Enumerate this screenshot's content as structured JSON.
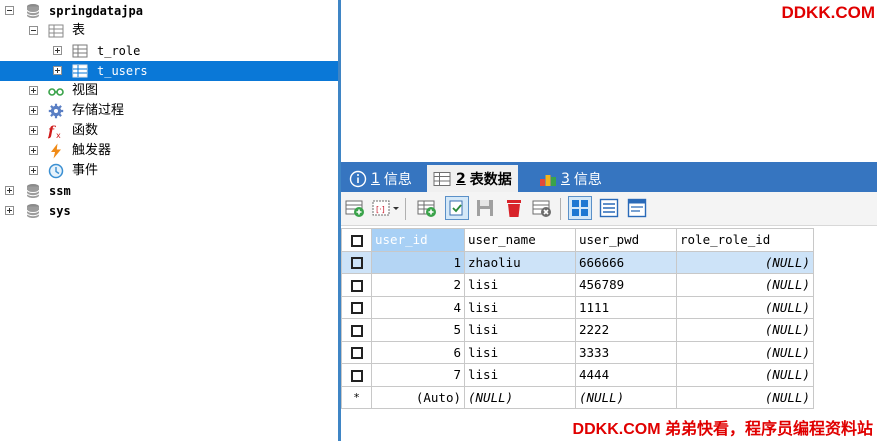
{
  "tree": {
    "db_springdatajpa": "springdatajpa",
    "tables_folder": "表",
    "table_role": "t_role",
    "table_users": "t_users",
    "views": "视图",
    "procedures": "存储过程",
    "functions": "函数",
    "triggers": "触发器",
    "events": "事件",
    "db_ssm": "ssm",
    "db_sys": "sys"
  },
  "watermark_top": "DDKK.COM",
  "watermark_bottom": "DDKK.COM 弟弟快看，程序员编程资料站",
  "tabs": [
    {
      "num": "1",
      "label": "信息",
      "active": false
    },
    {
      "num": "2",
      "label": "表数据",
      "active": true
    },
    {
      "num": "3",
      "label": "信息",
      "active": false
    }
  ],
  "grid": {
    "columns": [
      "user_id",
      "user_name",
      "user_pwd",
      "role_role_id"
    ],
    "rows": [
      {
        "user_id": "1",
        "user_name": "zhaoliu",
        "user_pwd": "666666",
        "role_role_id": "(NULL)"
      },
      {
        "user_id": "2",
        "user_name": "lisi",
        "user_pwd": "456789",
        "role_role_id": "(NULL)"
      },
      {
        "user_id": "4",
        "user_name": "lisi",
        "user_pwd": "1111",
        "role_role_id": "(NULL)"
      },
      {
        "user_id": "5",
        "user_name": "lisi",
        "user_pwd": "2222",
        "role_role_id": "(NULL)"
      },
      {
        "user_id": "6",
        "user_name": "lisi",
        "user_pwd": "3333",
        "role_role_id": "(NULL)"
      },
      {
        "user_id": "7",
        "user_name": "lisi",
        "user_pwd": "4444",
        "role_role_id": "(NULL)"
      }
    ],
    "new_row": {
      "marker": "*",
      "user_id": "(Auto)",
      "user_name": "(NULL)",
      "user_pwd": "(NULL)",
      "role_role_id": "(NULL)"
    }
  },
  "colors": {
    "tab_bar": "#3675c0",
    "selection": "#0a78d7",
    "watermark": "#e00000"
  }
}
